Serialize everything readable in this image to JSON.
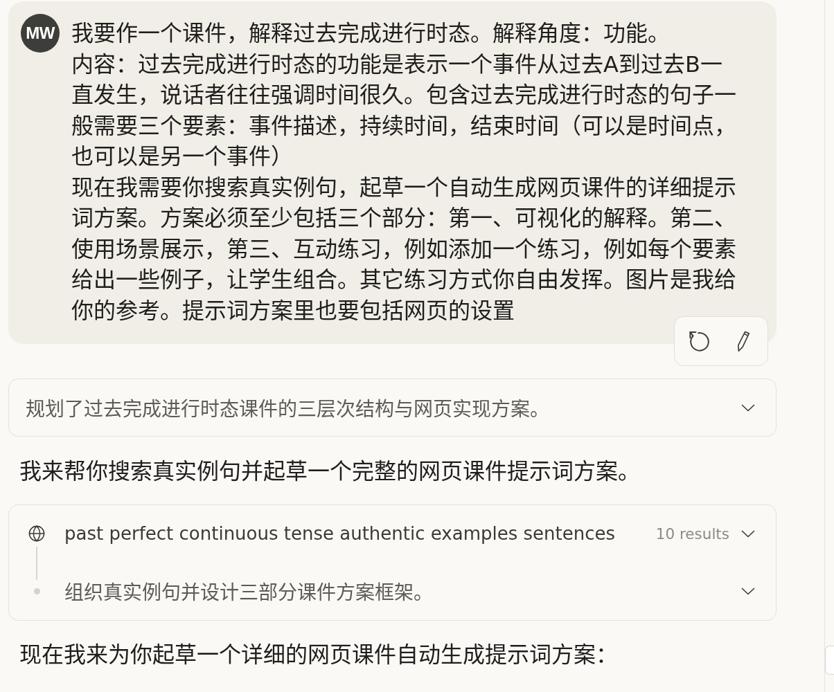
{
  "user_message": {
    "avatar": "MW",
    "paragraphs": [
      "我要作一个课件，解释过去完成进行时态。解释角度：功能。",
      "内容：过去完成进行时态的功能是表示一个事件从过去A到过去B一直发生，说话者往往强调时间很久。包含过去完成进行时态的句子一般需要三个要素：事件描述，持续时间，结束时间（可以是时间点，也可以是另一个事件）",
      "现在我需要你搜索真实例句，起草一个自动生成网页课件的详细提示词方案。方案必须至少包括三个部分：第一、可视化的解释。第二、使用场景展示，第三、互动练习，例如添加一个练习，例如每个要素给出一些例子，让学生组合。其它练习方式你自由发挥。图片是我给你的参考。提示词方案里也要包括网页的设置"
    ],
    "actions": [
      {
        "kind": "retry"
      },
      {
        "kind": "edit"
      }
    ]
  },
  "thinking_summary": {
    "text": "规划了过去完成进行时态课件的三层次结构与网页实现方案。",
    "expanded": false
  },
  "reply_intro": "我来帮你搜索真实例句并起草一个完整的网页课件提示词方案。",
  "tool_use": {
    "search": {
      "query": "past perfect continuous tense authentic examples sentences",
      "result_count": "10 results",
      "expanded": false
    },
    "step": {
      "text": "组织真实例句并设计三部分课件方案框架。",
      "expanded": false
    }
  },
  "reply_continuation": "现在我来为你起草一个详细的网页课件自动生成提示词方案："
}
